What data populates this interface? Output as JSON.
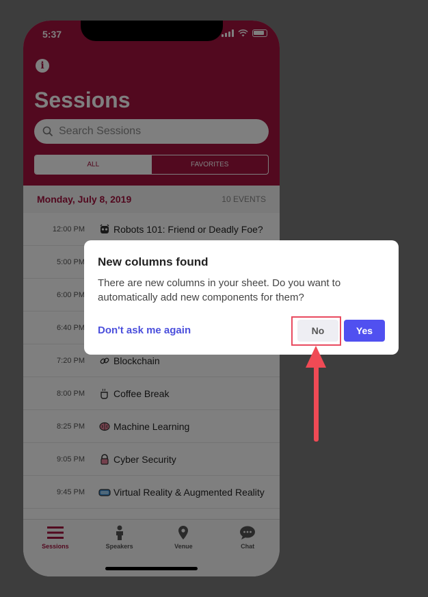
{
  "status": {
    "time": "5:37"
  },
  "header": {
    "title": "Sessions",
    "search_placeholder": "Search Sessions",
    "segments": [
      "ALL",
      "FAVORITES"
    ]
  },
  "date_bar": {
    "date": "Monday, July 8, 2019",
    "count": "10 EVENTS"
  },
  "sessions": [
    {
      "time": "12:00 PM",
      "emoji": "😈",
      "title": "Robots 101: Friend or Deadly Foe?"
    },
    {
      "time": "5:00 PM",
      "emoji": "",
      "title": ""
    },
    {
      "time": "6:00 PM",
      "emoji": "",
      "title": ""
    },
    {
      "time": "6:40 PM",
      "emoji": "",
      "title": ""
    },
    {
      "time": "7:20 PM",
      "emoji": "🔗",
      "title": "Blockchain"
    },
    {
      "time": "8:00 PM",
      "emoji": "☕",
      "title": "Coffee Break"
    },
    {
      "time": "8:25 PM",
      "emoji": "🧠",
      "title": "Machine Learning"
    },
    {
      "time": "9:05 PM",
      "emoji": "🔒",
      "title": "Cyber Security"
    },
    {
      "time": "9:45 PM",
      "emoji": "🥽",
      "title": "Virtual Reality & Augmented Reality"
    }
  ],
  "tabs": [
    {
      "label": "Sessions",
      "icon": "menu-icon"
    },
    {
      "label": "Speakers",
      "icon": "person-icon"
    },
    {
      "label": "Venue",
      "icon": "location-icon"
    },
    {
      "label": "Chat",
      "icon": "chat-icon"
    }
  ],
  "dialog": {
    "title": "New columns found",
    "body": "There are new columns in your sheet. Do you want to automatically add new components for them?",
    "dont_ask": "Don't ask me again",
    "no": "No",
    "yes": "Yes"
  },
  "colors": {
    "brand": "#a4123f",
    "accent": "#5050f0",
    "annotation": "#f04a55"
  }
}
